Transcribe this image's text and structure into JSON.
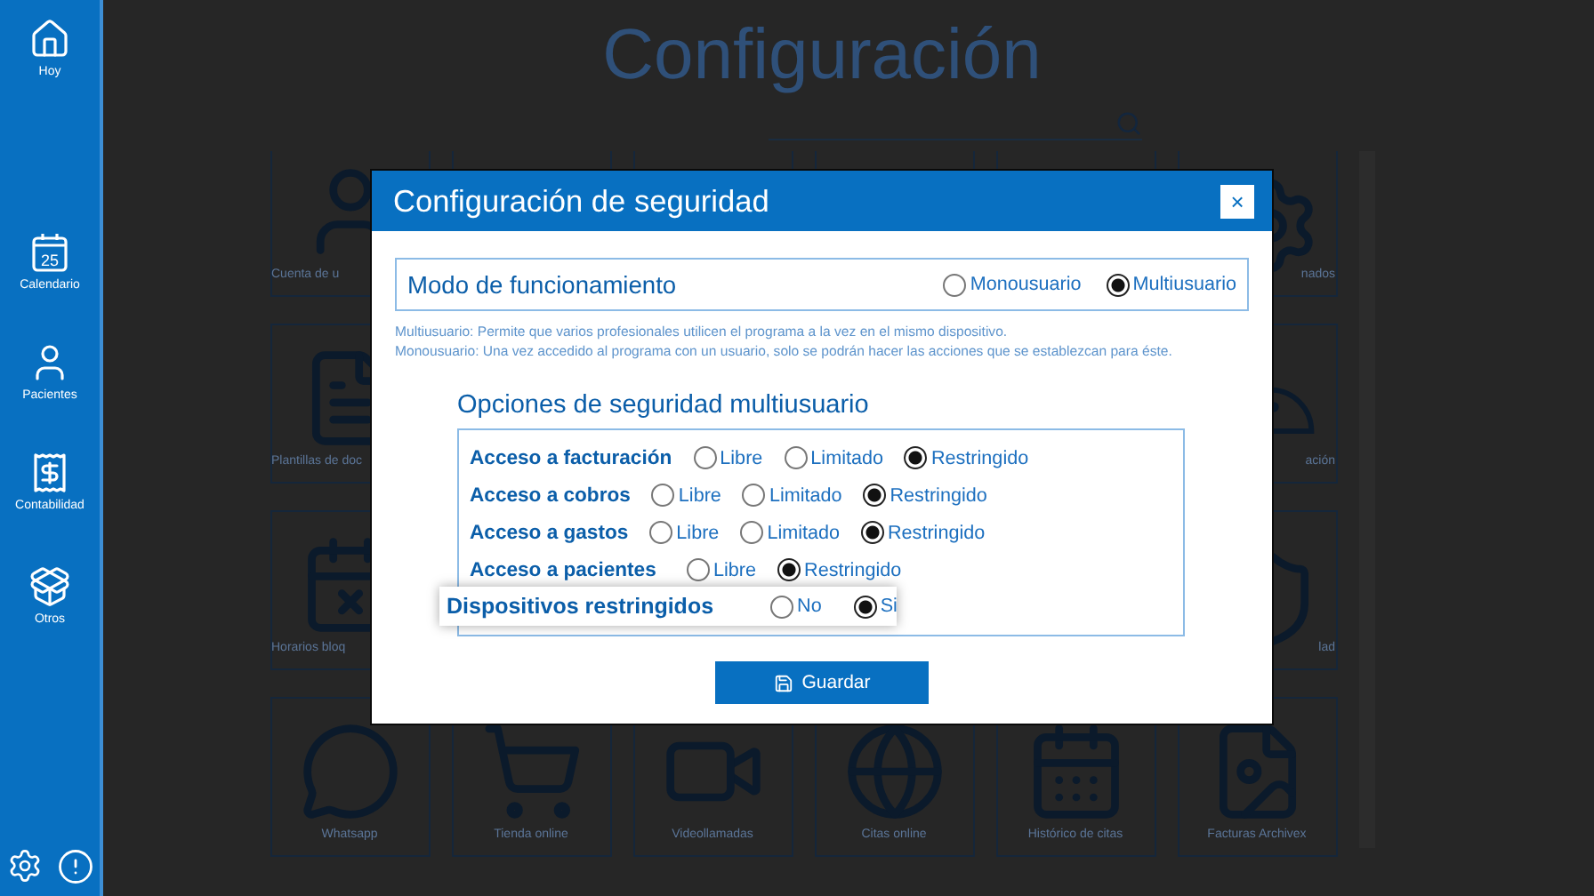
{
  "sidebar": {
    "items": [
      {
        "label": "Hoy",
        "kind": "home"
      },
      {
        "label": "Calendario",
        "kind": "calendar",
        "day": "25"
      },
      {
        "label": "Pacientes",
        "kind": "person"
      },
      {
        "label": "Contabilidad",
        "kind": "receipt"
      },
      {
        "label": "Otros",
        "kind": "box"
      }
    ]
  },
  "page": {
    "title": "Configuración"
  },
  "tiles": {
    "covered_rows": [
      {
        "left": "Cuenta de u",
        "right": "nados"
      },
      {
        "left": "Plantillas de doc",
        "right": "ación"
      },
      {
        "left": "Horarios bloq",
        "right": "lad"
      }
    ],
    "bottom_row": [
      "Whatsapp",
      "Tienda online",
      "Videollamadas",
      "Citas online",
      "Histórico de citas",
      "Facturas Archivex"
    ]
  },
  "dialog": {
    "title": "Configuración de seguridad",
    "close": "×",
    "mode": {
      "label": "Modo de funcionamiento",
      "options": [
        {
          "label": "Monousuario",
          "selected": false
        },
        {
          "label": "Multiusuario",
          "selected": true
        }
      ]
    },
    "notes": [
      "Multiusuario: Permite que varios profesionales utilicen el programa a la vez en el mismo dispositivo.",
      "Monousuario: Una vez accedido al programa con un usuario, solo se podrán hacer las acciones que se establezcan para éste."
    ],
    "options_title": "Opciones de seguridad multiusuario",
    "options": [
      {
        "label": "Acceso a facturación",
        "choices": [
          {
            "label": "Libre",
            "selected": false
          },
          {
            "label": "Limitado",
            "selected": false
          },
          {
            "label": "Restringido",
            "selected": true
          }
        ]
      },
      {
        "label": "Acceso a cobros",
        "choices": [
          {
            "label": "Libre",
            "selected": false
          },
          {
            "label": "Limitado",
            "selected": false
          },
          {
            "label": "Restringido",
            "selected": true
          }
        ]
      },
      {
        "label": "Acceso a gastos",
        "choices": [
          {
            "label": "Libre",
            "selected": false
          },
          {
            "label": "Limitado",
            "selected": false
          },
          {
            "label": "Restringido",
            "selected": true
          }
        ]
      },
      {
        "label": "Acceso a pacientes",
        "choices": [
          {
            "label": "Libre",
            "selected": false
          },
          {
            "label": "Restringido",
            "selected": true
          }
        ]
      }
    ],
    "devices": {
      "label": "Dispositivos restringidos",
      "choices": [
        {
          "label": "No",
          "selected": false
        },
        {
          "label": "Si",
          "selected": true
        }
      ]
    },
    "save": "Guardar"
  }
}
